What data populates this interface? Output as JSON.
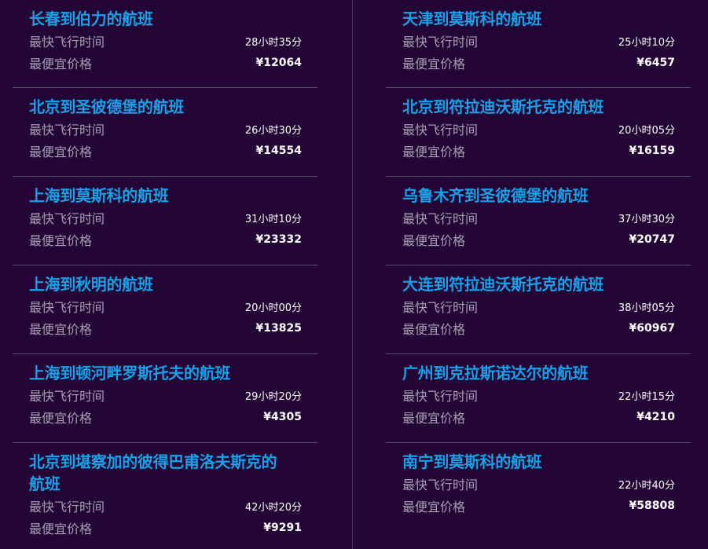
{
  "labels": {
    "fastest": "最快飞行时间",
    "cheapest": "最便宜价格"
  },
  "left_column": [
    {
      "title": "长春到伯力的航班",
      "duration": "28小时35分",
      "price": "¥12064"
    },
    {
      "title": "北京到圣彼德堡的航班",
      "duration": "26小时30分",
      "price": "¥14554"
    },
    {
      "title": "上海到莫斯科的航班",
      "duration": "31小时10分",
      "price": "¥23332"
    },
    {
      "title": "上海到秋明的航班",
      "duration": "20小时00分",
      "price": "¥13825"
    },
    {
      "title": "上海到顿河畔罗斯托夫的航班",
      "duration": "29小时20分",
      "price": "¥4305"
    },
    {
      "title": "北京到堪察加的彼得巴甫洛夫斯克的航班",
      "duration": "42小时20分",
      "price": "¥9291"
    }
  ],
  "right_column": [
    {
      "title": "天津到莫斯科的航班",
      "duration": "25小时10分",
      "price": "¥6457"
    },
    {
      "title": "北京到符拉迪沃斯托克的航班",
      "duration": "20小时05分",
      "price": "¥16159"
    },
    {
      "title": "乌鲁木齐到圣彼德堡的航班",
      "duration": "37小时30分",
      "price": "¥20747"
    },
    {
      "title": "大连到符拉迪沃斯托克的航班",
      "duration": "38小时05分",
      "price": "¥60967"
    },
    {
      "title": "广州到克拉斯诺达尔的航班",
      "duration": "22小时15分",
      "price": "¥4210"
    },
    {
      "title": "南宁到莫斯科的航班",
      "duration": "22小时40分",
      "price": "¥58808"
    }
  ]
}
